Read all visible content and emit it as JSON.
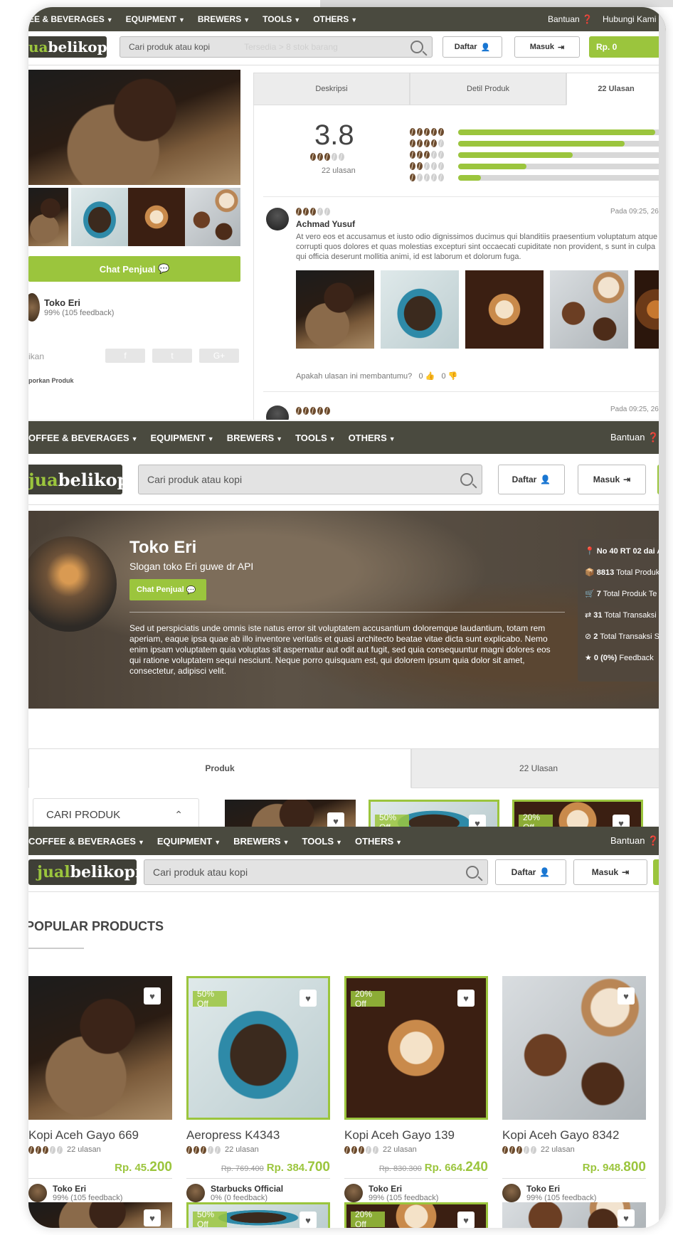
{
  "nav": {
    "categories": [
      "COFFEE & BEVERAGES",
      "EQUIPMENT",
      "BREWERS",
      "TOOLS",
      "OTHERS"
    ],
    "categories_cut_top": [
      "EE & BEVERAGES",
      "EQUIPMENT",
      "BREWERS",
      "TOOLS",
      "OTHERS"
    ],
    "categories_cut_mid": [
      "OFFEE & BEVERAGES",
      "EQUIPMENT",
      "BREWERS",
      "TOOLS",
      "OTHERS"
    ],
    "help": "Bantuan",
    "contact": "Hubungi Kami"
  },
  "header": {
    "logo_prefix_top": "jual",
    "logo_prefix": "jual",
    "logo_suffix": "belikopi",
    "logo_cut_top": "ua",
    "logo_cut_mid": "jua",
    "search_placeholder": "Cari produk atau kopi",
    "register": "Daftar",
    "login": "Masuk",
    "cart": "Rp. 0",
    "ghost_stock": "Tersedia > 8 stok barang",
    "accent": "#9bc53d",
    "dark": "#4a4a3f"
  },
  "product_page": {
    "chat_button": "Chat Penjual",
    "seller_name": "Toko Eri",
    "seller_feedback": "99% (105 feedback)",
    "share_label": "ikan",
    "share_buttons": [
      "f",
      "t",
      "G+"
    ],
    "report": "porkan Produk",
    "tabs": [
      "Deskripsi",
      "Detil Produk",
      "22 Ulasan"
    ],
    "rating_value": "3.8",
    "rating_count": "22 ulasan",
    "rating_breakdown": [
      {
        "stars": 5,
        "fraction": 0.95
      },
      {
        "stars": 4,
        "fraction": 0.8
      },
      {
        "stars": 3,
        "fraction": 0.55
      },
      {
        "stars": 2,
        "fraction": 0.33
      },
      {
        "stars": 1,
        "fraction": 0.11
      }
    ],
    "review": {
      "author": "Achmad Yusuf",
      "date": "Pada 09:25, 26 Se",
      "stars": 3,
      "text": "At vero eos et accusamus et iusto odio dignissimos ducimus qui blanditiis praesentium voluptatum atque corrupti quos dolores et quas molestias excepturi sint occaecati cupiditate non provident, s sunt in culpa qui officia deserunt mollitia animi, id est laborum et dolorum fuga.",
      "helpful": "Apakah ulasan ini membantumu?",
      "up": "0",
      "down": "0"
    },
    "review2_date": "Pada 09:25, 26 Se"
  },
  "store_page": {
    "name": "Toko Eri",
    "slogan": "Slogan toko Eri guwe dr API",
    "chat_button": "Chat Penjual",
    "description": "Sed ut perspiciatis unde omnis iste natus error sit voluptatem accusantium doloremque laudantium, totam rem aperiam, eaque ipsa quae ab illo inventore veritatis et quasi architecto beatae vitae dicta sunt explicabo. Nemo enim ipsam voluptatem quia voluptas sit aspernatur aut odit aut fugit, sed quia consequuntur magni dolores eos qui ratione voluptatem sequi nesciunt. Neque porro quisquam est, qui dolorem ipsum quia dolor sit amet, consectetur, adipisci velit.",
    "stats": [
      {
        "bold": "No 40 RT 02 dai A",
        "rest": ""
      },
      {
        "bold": "8813",
        "rest": " Total Produk"
      },
      {
        "bold": "7",
        "rest": " Total Produk Te"
      },
      {
        "bold": "31",
        "rest": " Total Transaksi"
      },
      {
        "bold": "2",
        "rest": " Total Transaksi S"
      },
      {
        "bold": "0 (0%)",
        "rest": " Feedback"
      }
    ],
    "tabs": [
      "Produk",
      "22 Ulasan"
    ],
    "filter_title": "CARI PRODUK",
    "badges": [
      "50% Off",
      "20% Off"
    ]
  },
  "home": {
    "section_title": "POPULAR PRODUCTS",
    "products": [
      {
        "name": "Kopi Aceh Gayo 669",
        "reviews": "22 ulasan",
        "old_price": "",
        "price_main": "Rp. 45.",
        "price_tail": "200",
        "seller": "Toko Eri",
        "feedback": "99% (105 feedback)",
        "badge": ""
      },
      {
        "name": "Aeropress K4343",
        "reviews": "22 ulasan",
        "old_price": "Rp. 769.400",
        "price_main": "Rp. 384.",
        "price_tail": "700",
        "seller": "Starbucks Official",
        "feedback": "0% (0 feedback)",
        "badge": "50% Off"
      },
      {
        "name": "Kopi Aceh Gayo 139",
        "reviews": "22 ulasan",
        "old_price": "Rp. 830.300",
        "price_main": "Rp. 664.",
        "price_tail": "240",
        "seller": "Toko Eri",
        "feedback": "99% (105 feedback)",
        "badge": "20% Off"
      },
      {
        "name": "Kopi Aceh Gayo 8342",
        "reviews": "22 ulasan",
        "old_price": "",
        "price_main": "Rp. 948.",
        "price_tail": "800",
        "seller": "Toko Eri",
        "feedback": "99% (105 feedback)",
        "badge": ""
      }
    ],
    "next_row_badges": [
      "50% Off",
      "20% Off"
    ]
  }
}
